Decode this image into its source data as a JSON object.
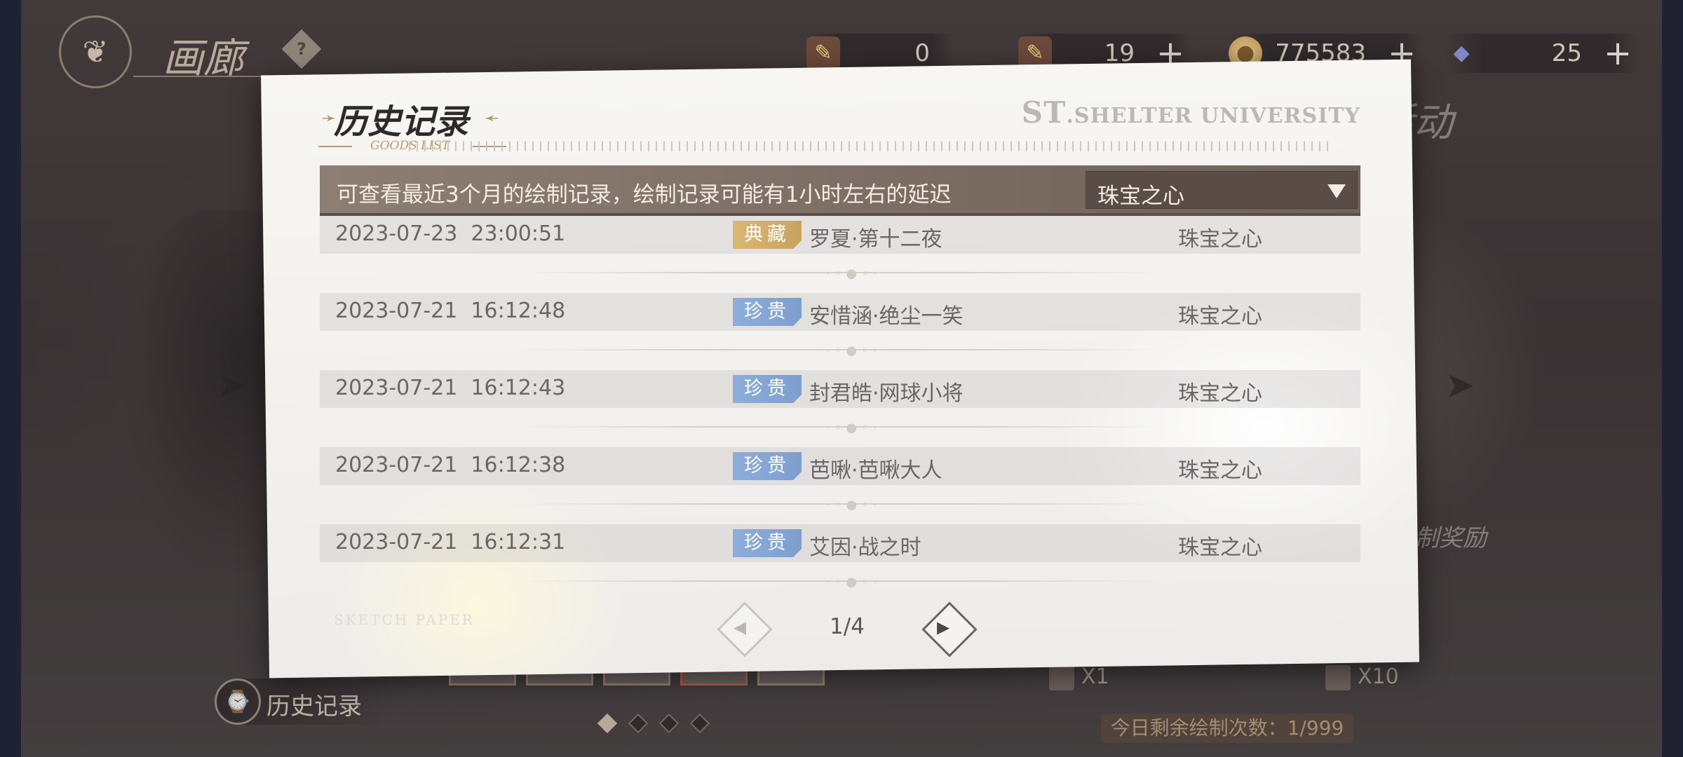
{
  "header": {
    "gallery_title": "画廊",
    "help_symbol": "?",
    "resources": [
      {
        "icon": "ticket-icon",
        "value": "0",
        "has_plus": false
      },
      {
        "icon": "ticket-icon",
        "value": "19",
        "has_plus": true
      },
      {
        "icon": "coin-icon",
        "value": "775583",
        "has_plus": true
      },
      {
        "icon": "diamond-icon",
        "value": "25",
        "has_plus": true
      }
    ],
    "plus_symbol": "+"
  },
  "modal": {
    "title": "历史记录",
    "subtitle": "GOODS LIST",
    "brand_prefix": "ST",
    "brand_rest": ".SHELTER UNIVERSITY",
    "info_text": "可查看最近3个月的绘制记录，绘制记录可能有1小时左右的延迟",
    "dropdown_value": "珠宝之心",
    "watermark": "SKETCH PAPER",
    "pagination": "1/4",
    "rows": [
      {
        "datetime": "2023-07-23  23:00:51",
        "rarity": "典藏",
        "rarity_color": "#d9b775",
        "name": "罗夏·第十二夜",
        "pool": "珠宝之心"
      },
      {
        "datetime": "2023-07-21  16:12:48",
        "rarity": "珍贵",
        "rarity_color": "#8daedb",
        "name": "安惜涵·绝尘一笑",
        "pool": "珠宝之心"
      },
      {
        "datetime": "2023-07-21  16:12:43",
        "rarity": "珍贵",
        "rarity_color": "#8daedb",
        "name": "封君皓·网球小将",
        "pool": "珠宝之心"
      },
      {
        "datetime": "2023-07-21  16:12:38",
        "rarity": "珍贵",
        "rarity_color": "#8daedb",
        "name": "芭啾·芭啾大人",
        "pool": "珠宝之心"
      },
      {
        "datetime": "2023-07-21  16:12:31",
        "rarity": "珍贵",
        "rarity_color": "#8daedb",
        "name": "艾因·战之时",
        "pool": "珠宝之心"
      }
    ]
  },
  "background": {
    "side_label_top": "活动",
    "side_label_mid": "制奖励",
    "history_button": "历史记录",
    "draw_once": "X1",
    "draw_ten": "X10",
    "remaining": "今日剩余绘制次数：1/999",
    "page_dots": 4,
    "active_dot": 0
  }
}
